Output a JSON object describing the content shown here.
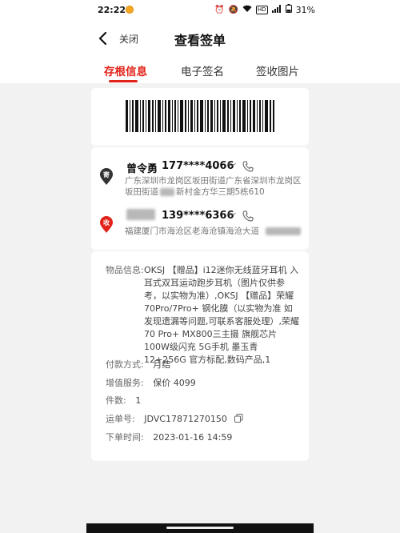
{
  "status_bar": {
    "time": "22:22",
    "battery": "31%",
    "network_badge": "HD"
  },
  "header": {
    "title": "查看签单",
    "close_label": "关闭"
  },
  "tabs": [
    {
      "label": "存根信息",
      "active": true
    },
    {
      "label": "电子签名",
      "active": false
    },
    {
      "label": "签收图片",
      "active": false
    }
  ],
  "sender": {
    "badge": "寄",
    "name": "曾令勇",
    "phone": "177****4066",
    "address_line1": "广东深圳市龙岗区坂田街道广东省深圳市龙岗区",
    "address_line2_a": "坂田街道",
    "address_line2_b": "新村金方华三期5栋610"
  },
  "receiver": {
    "badge": "收",
    "phone": "139****6366",
    "address": "福建厦门市海沧区老海沧镇海沧大道"
  },
  "order": {
    "goods_label": "物品信息:",
    "goods_value": "OKSJ 【赠品】i12迷你无线蓝牙耳机 入耳式双耳运动跑步耳机（图片仅供参考，以实物为准）,OKSJ 【赠品】荣耀70Pro/7Pro+ 钢化膜（以实物为准 如发现遗漏等问题,可联系客服处理）,荣耀70 Pro+ MX800三主摄 旗舰芯片 100W级闪充 5G手机 墨玉青 12+256G 官方标配,数码产品,1",
    "payment_label": "付款方式:",
    "payment_value": "月结",
    "valueadded_label": "增值服务:",
    "valueadded_value": "保价 4099",
    "count_label": "件数:",
    "count_value": "1",
    "waybill_label": "运单号:",
    "waybill_value": "JDVC17871270150",
    "ordertime_label": "下单时间:",
    "ordertime_value": "2023-01-16 14:59"
  },
  "colors": {
    "accent": "#e2231a",
    "sender_pin": "#333333",
    "receiver_pin": "#e2231a"
  },
  "icons": [
    "back-arrow-icon",
    "eye-closed-icon",
    "phone-icon",
    "copy-icon",
    "barcode"
  ]
}
